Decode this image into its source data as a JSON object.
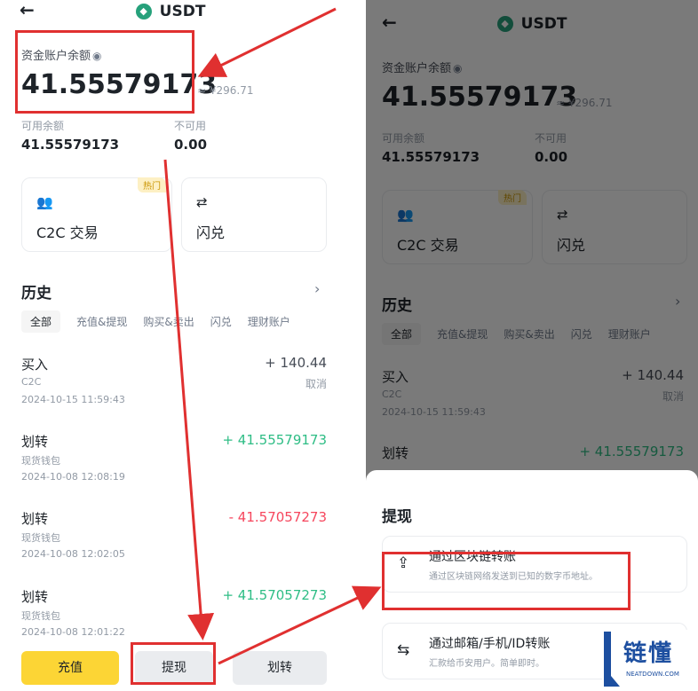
{
  "screen": {
    "back_icon": "←",
    "coin_icon": "usdt-coin-icon",
    "title": "USDT",
    "balance_label": "资金账户余额",
    "eye_icon": "eye-icon",
    "balance": "41.55579173",
    "fiat": "≈ ¥296.71",
    "available_label": "可用余额",
    "available_value": "41.55579173",
    "unavailable_label": "不可用",
    "unavailable_value": "0.00",
    "cards": [
      {
        "label": "C2C 交易",
        "icon": "users-icon",
        "badge": "热门"
      },
      {
        "label": "闪兑",
        "icon": "swap-icon"
      }
    ],
    "history_title": "历史",
    "history_chevron": "›",
    "tabs": [
      "全部",
      "充值&提现",
      "购买&卖出",
      "闪兑",
      "理财账户"
    ],
    "transactions": [
      {
        "name": "买入",
        "sub": "C2C",
        "time": "2024-10-15 11:59:43",
        "amount": "+ 140.44",
        "status": "取消",
        "color": "#474d57"
      },
      {
        "name": "划转",
        "sub": "现货钱包",
        "time": "2024-10-08 12:08:19",
        "amount": "+ 41.55579173",
        "status": "",
        "color": "#2ebd85"
      },
      {
        "name": "划转",
        "sub": "现货钱包",
        "time": "2024-10-08 12:02:05",
        "amount": "- 41.57057273",
        "status": "",
        "color": "#f6465d"
      },
      {
        "name": "划转",
        "sub": "现货钱包",
        "time": "2024-10-08 12:01:22",
        "amount": "+ 41.57057273",
        "status": "",
        "color": "#2ebd85"
      }
    ],
    "buttons": {
      "deposit": "充值",
      "withdraw": "提现",
      "transfer": "划转"
    }
  },
  "sheet": {
    "title": "提现",
    "options": [
      {
        "title": "通过区块链转账",
        "sub": "通过区块链网络发送到已知的数字币地址。",
        "icon": "upload-icon"
      },
      {
        "title": "通过邮箱/手机/ID转账",
        "sub": "汇款给币安用户。简单即时。",
        "icon": "transfer-user-icon"
      }
    ]
  },
  "watermark": {
    "text": "链懂",
    "sub": "NEATDOWN.COM"
  },
  "colors": {
    "highlight": "#e03030",
    "accent": "#fcd535",
    "positive": "#2ebd85",
    "negative": "#f6465d"
  }
}
